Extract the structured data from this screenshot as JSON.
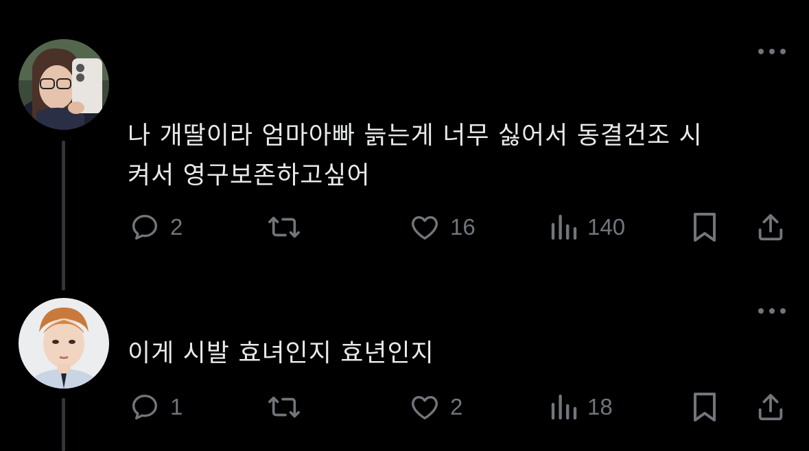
{
  "colors": {
    "background": "#000000",
    "text": "#e7e9ea",
    "secondary": "#71767b",
    "thread_line": "#333639"
  },
  "tweets": [
    {
      "avatar": "user-avatar-photo",
      "text": "나 개딸이라 엄마아빠 늙는게 너무 싫어서 동결건조 시\n켜서 영구보존하고싶어",
      "replies": "2",
      "retweets": "",
      "likes": "16",
      "views": "140"
    },
    {
      "avatar": "user-avatar-photo",
      "text": "이게 시발 효녀인지 효년인지",
      "replies": "1",
      "retweets": "",
      "likes": "2",
      "views": "18"
    }
  ],
  "icons": [
    "reply-icon",
    "retweet-icon",
    "like-icon",
    "views-icon",
    "bookmark-icon",
    "share-icon",
    "more-icon"
  ]
}
